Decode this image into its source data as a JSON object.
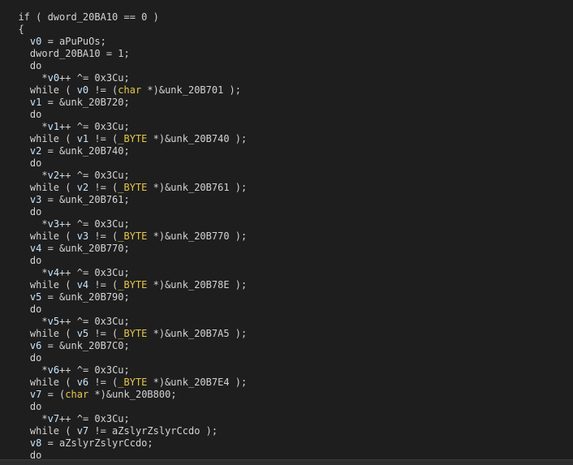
{
  "colors": {
    "background": "#1e1e1e",
    "text": "#d4d4d4",
    "variable": "#c8e6ff",
    "type_keyword": "#e6c84a"
  },
  "code_lines": [
    {
      "indent": 1,
      "tokens": [
        {
          "t": "if ( dword_20BA10 == 0 )",
          "c": "plain"
        }
      ]
    },
    {
      "indent": 1,
      "tokens": [
        {
          "t": "{",
          "c": "plain"
        }
      ]
    },
    {
      "indent": 2,
      "tokens": [
        {
          "t": "v0",
          "c": "var"
        },
        {
          "t": " = aPuPuOs;",
          "c": "plain"
        }
      ]
    },
    {
      "indent": 2,
      "tokens": [
        {
          "t": "dword_20BA10 = 1;",
          "c": "plain"
        }
      ]
    },
    {
      "indent": 2,
      "tokens": [
        {
          "t": "do",
          "c": "plain"
        }
      ]
    },
    {
      "indent": 3,
      "tokens": [
        {
          "t": "*",
          "c": "plain"
        },
        {
          "t": "v0",
          "c": "var"
        },
        {
          "t": "++ ^= 0x3Cu;",
          "c": "plain"
        }
      ]
    },
    {
      "indent": 2,
      "tokens": [
        {
          "t": "while ( ",
          "c": "plain"
        },
        {
          "t": "v0",
          "c": "var"
        },
        {
          "t": " != (",
          "c": "plain"
        },
        {
          "t": "char",
          "c": "type"
        },
        {
          "t": " *)&unk_20B701 );",
          "c": "plain"
        }
      ]
    },
    {
      "indent": 2,
      "tokens": [
        {
          "t": "v1",
          "c": "var"
        },
        {
          "t": " = &unk_20B720;",
          "c": "plain"
        }
      ]
    },
    {
      "indent": 2,
      "tokens": [
        {
          "t": "do",
          "c": "plain"
        }
      ]
    },
    {
      "indent": 3,
      "tokens": [
        {
          "t": "*",
          "c": "plain"
        },
        {
          "t": "v1",
          "c": "var"
        },
        {
          "t": "++ ^= 0x3Cu;",
          "c": "plain"
        }
      ]
    },
    {
      "indent": 2,
      "tokens": [
        {
          "t": "while ( ",
          "c": "plain"
        },
        {
          "t": "v1",
          "c": "var"
        },
        {
          "t": " != (",
          "c": "plain"
        },
        {
          "t": "_BYTE",
          "c": "type"
        },
        {
          "t": " *)&unk_20B740 );",
          "c": "plain"
        }
      ]
    },
    {
      "indent": 2,
      "tokens": [
        {
          "t": "v2",
          "c": "var"
        },
        {
          "t": " = &unk_20B740;",
          "c": "plain"
        }
      ]
    },
    {
      "indent": 2,
      "tokens": [
        {
          "t": "do",
          "c": "plain"
        }
      ]
    },
    {
      "indent": 3,
      "tokens": [
        {
          "t": "*",
          "c": "plain"
        },
        {
          "t": "v2",
          "c": "var"
        },
        {
          "t": "++ ^= 0x3Cu;",
          "c": "plain"
        }
      ]
    },
    {
      "indent": 2,
      "tokens": [
        {
          "t": "while ( ",
          "c": "plain"
        },
        {
          "t": "v2",
          "c": "var"
        },
        {
          "t": " != (",
          "c": "plain"
        },
        {
          "t": "_BYTE",
          "c": "type"
        },
        {
          "t": " *)&unk_20B761 );",
          "c": "plain"
        }
      ]
    },
    {
      "indent": 2,
      "tokens": [
        {
          "t": "v3",
          "c": "var"
        },
        {
          "t": " = &unk_20B761;",
          "c": "plain"
        }
      ]
    },
    {
      "indent": 2,
      "tokens": [
        {
          "t": "do",
          "c": "plain"
        }
      ]
    },
    {
      "indent": 3,
      "tokens": [
        {
          "t": "*",
          "c": "plain"
        },
        {
          "t": "v3",
          "c": "var"
        },
        {
          "t": "++ ^= 0x3Cu;",
          "c": "plain"
        }
      ]
    },
    {
      "indent": 2,
      "tokens": [
        {
          "t": "while ( ",
          "c": "plain"
        },
        {
          "t": "v3",
          "c": "var"
        },
        {
          "t": " != (",
          "c": "plain"
        },
        {
          "t": "_BYTE",
          "c": "type"
        },
        {
          "t": " *)&unk_20B770 );",
          "c": "plain"
        }
      ]
    },
    {
      "indent": 2,
      "tokens": [
        {
          "t": "v4",
          "c": "var"
        },
        {
          "t": " = &unk_20B770;",
          "c": "plain"
        }
      ]
    },
    {
      "indent": 2,
      "tokens": [
        {
          "t": "do",
          "c": "plain"
        }
      ]
    },
    {
      "indent": 3,
      "tokens": [
        {
          "t": "*",
          "c": "plain"
        },
        {
          "t": "v4",
          "c": "var"
        },
        {
          "t": "++ ^= 0x3Cu;",
          "c": "plain"
        }
      ]
    },
    {
      "indent": 2,
      "tokens": [
        {
          "t": "while ( ",
          "c": "plain"
        },
        {
          "t": "v4",
          "c": "var"
        },
        {
          "t": " != (",
          "c": "plain"
        },
        {
          "t": "_BYTE",
          "c": "type"
        },
        {
          "t": " *)&unk_20B78E );",
          "c": "plain"
        }
      ]
    },
    {
      "indent": 2,
      "tokens": [
        {
          "t": "v5",
          "c": "var"
        },
        {
          "t": " = &unk_20B790;",
          "c": "plain"
        }
      ]
    },
    {
      "indent": 2,
      "tokens": [
        {
          "t": "do",
          "c": "plain"
        }
      ]
    },
    {
      "indent": 3,
      "tokens": [
        {
          "t": "*",
          "c": "plain"
        },
        {
          "t": "v5",
          "c": "var"
        },
        {
          "t": "++ ^= 0x3Cu;",
          "c": "plain"
        }
      ]
    },
    {
      "indent": 2,
      "tokens": [
        {
          "t": "while ( ",
          "c": "plain"
        },
        {
          "t": "v5",
          "c": "var"
        },
        {
          "t": " != (",
          "c": "plain"
        },
        {
          "t": "_BYTE",
          "c": "type"
        },
        {
          "t": " *)&unk_20B7A5 );",
          "c": "plain"
        }
      ]
    },
    {
      "indent": 2,
      "tokens": [
        {
          "t": "v6",
          "c": "var"
        },
        {
          "t": " = &unk_20B7C0;",
          "c": "plain"
        }
      ]
    },
    {
      "indent": 2,
      "tokens": [
        {
          "t": "do",
          "c": "plain"
        }
      ]
    },
    {
      "indent": 3,
      "tokens": [
        {
          "t": "*",
          "c": "plain"
        },
        {
          "t": "v6",
          "c": "var"
        },
        {
          "t": "++ ^= 0x3Cu;",
          "c": "plain"
        }
      ]
    },
    {
      "indent": 2,
      "tokens": [
        {
          "t": "while ( ",
          "c": "plain"
        },
        {
          "t": "v6",
          "c": "var"
        },
        {
          "t": " != (",
          "c": "plain"
        },
        {
          "t": "_BYTE",
          "c": "type"
        },
        {
          "t": " *)&unk_20B7E4 );",
          "c": "plain"
        }
      ]
    },
    {
      "indent": 2,
      "tokens": [
        {
          "t": "v7",
          "c": "var"
        },
        {
          "t": " = (",
          "c": "plain"
        },
        {
          "t": "char",
          "c": "type"
        },
        {
          "t": " *)&unk_20B800;",
          "c": "plain"
        }
      ]
    },
    {
      "indent": 2,
      "tokens": [
        {
          "t": "do",
          "c": "plain"
        }
      ]
    },
    {
      "indent": 3,
      "tokens": [
        {
          "t": "*",
          "c": "plain"
        },
        {
          "t": "v7",
          "c": "var"
        },
        {
          "t": "++ ^= 0x3Cu;",
          "c": "plain"
        }
      ]
    },
    {
      "indent": 2,
      "tokens": [
        {
          "t": "while ( ",
          "c": "plain"
        },
        {
          "t": "v7",
          "c": "var"
        },
        {
          "t": " != aZslyrZslyrCcdo );",
          "c": "plain"
        }
      ]
    },
    {
      "indent": 2,
      "tokens": [
        {
          "t": "v8",
          "c": "var"
        },
        {
          "t": " = aZslyrZslyrCcdo;",
          "c": "plain"
        }
      ]
    },
    {
      "indent": 2,
      "tokens": [
        {
          "t": "do",
          "c": "plain"
        }
      ]
    }
  ]
}
